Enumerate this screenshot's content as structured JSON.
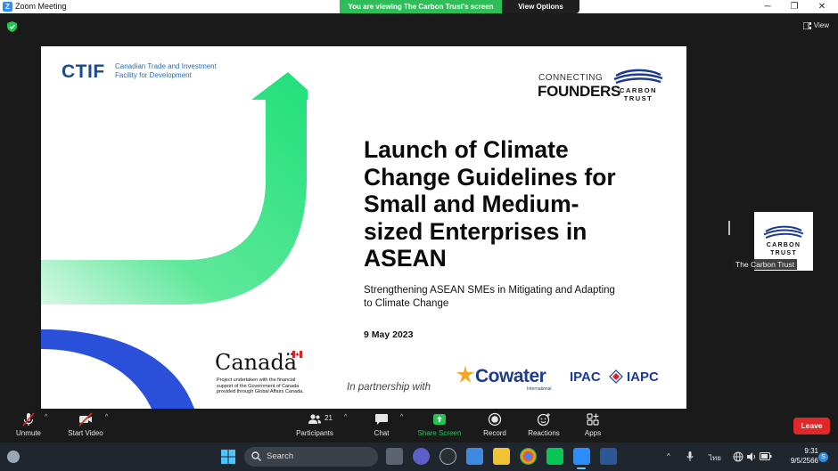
{
  "window": {
    "title": "Zoom Meeting",
    "app_icon_letter": "Z",
    "share_banner": "You are viewing The Carbon Trust's screen",
    "view_options": "View Options",
    "controls": [
      "─",
      "❐",
      "✕"
    ]
  },
  "meeting": {
    "view_label": "View"
  },
  "slide": {
    "ctif_logo": "CTIF",
    "ctif_tagline_line1": "Canadian Trade and Investment",
    "ctif_tagline_line2": "Facility for Development",
    "cf_connecting": "CONNECTING",
    "cf_founders": "FOUNDERS",
    "carbon_trust_line1": "CARBON",
    "carbon_trust_line2": "TRUST",
    "title_lines": [
      "Launch of Climate",
      "Change Guidelines for",
      "Small and Medium-",
      "sized Enterprises in",
      "ASEAN"
    ],
    "subtitle_line1": "Strengthening ASEAN SMEs in Mitigating and Adapting",
    "subtitle_line2": "to Climate Change",
    "date": "9 May 2023",
    "canada_wordmark": "Canadä",
    "canada_note_line1": "Project undertaken with the financial",
    "canada_note_line2": "support of the Government of Canada",
    "canada_note_line3": "provided through Global Affairs Canada.",
    "partnership": "In partnership with",
    "cowater": "Cowater",
    "cowater_sub": "International",
    "ipac_left": "IPAC",
    "ipac_right": "IAPC",
    "colors": {
      "green_arrow": "#2ee87a",
      "blue_arc": "#2a4fd8",
      "ctif_blue": "#1b4a8c"
    }
  },
  "participant": {
    "name": "The Carbon Trust",
    "logo_line1": "CARBON",
    "logo_line2": "TRUST"
  },
  "toolbar": {
    "unmute": "Unmute",
    "start_video": "Start Video",
    "participants": "Participants",
    "participants_count": "21",
    "chat": "Chat",
    "share_screen": "Share Screen",
    "record": "Record",
    "reactions": "Reactions",
    "apps": "Apps",
    "leave": "Leave"
  },
  "taskbar": {
    "search_placeholder": "Search",
    "language": "ไทย",
    "time": "9:31",
    "date": "9/5/2566",
    "notification_letter": "S"
  }
}
